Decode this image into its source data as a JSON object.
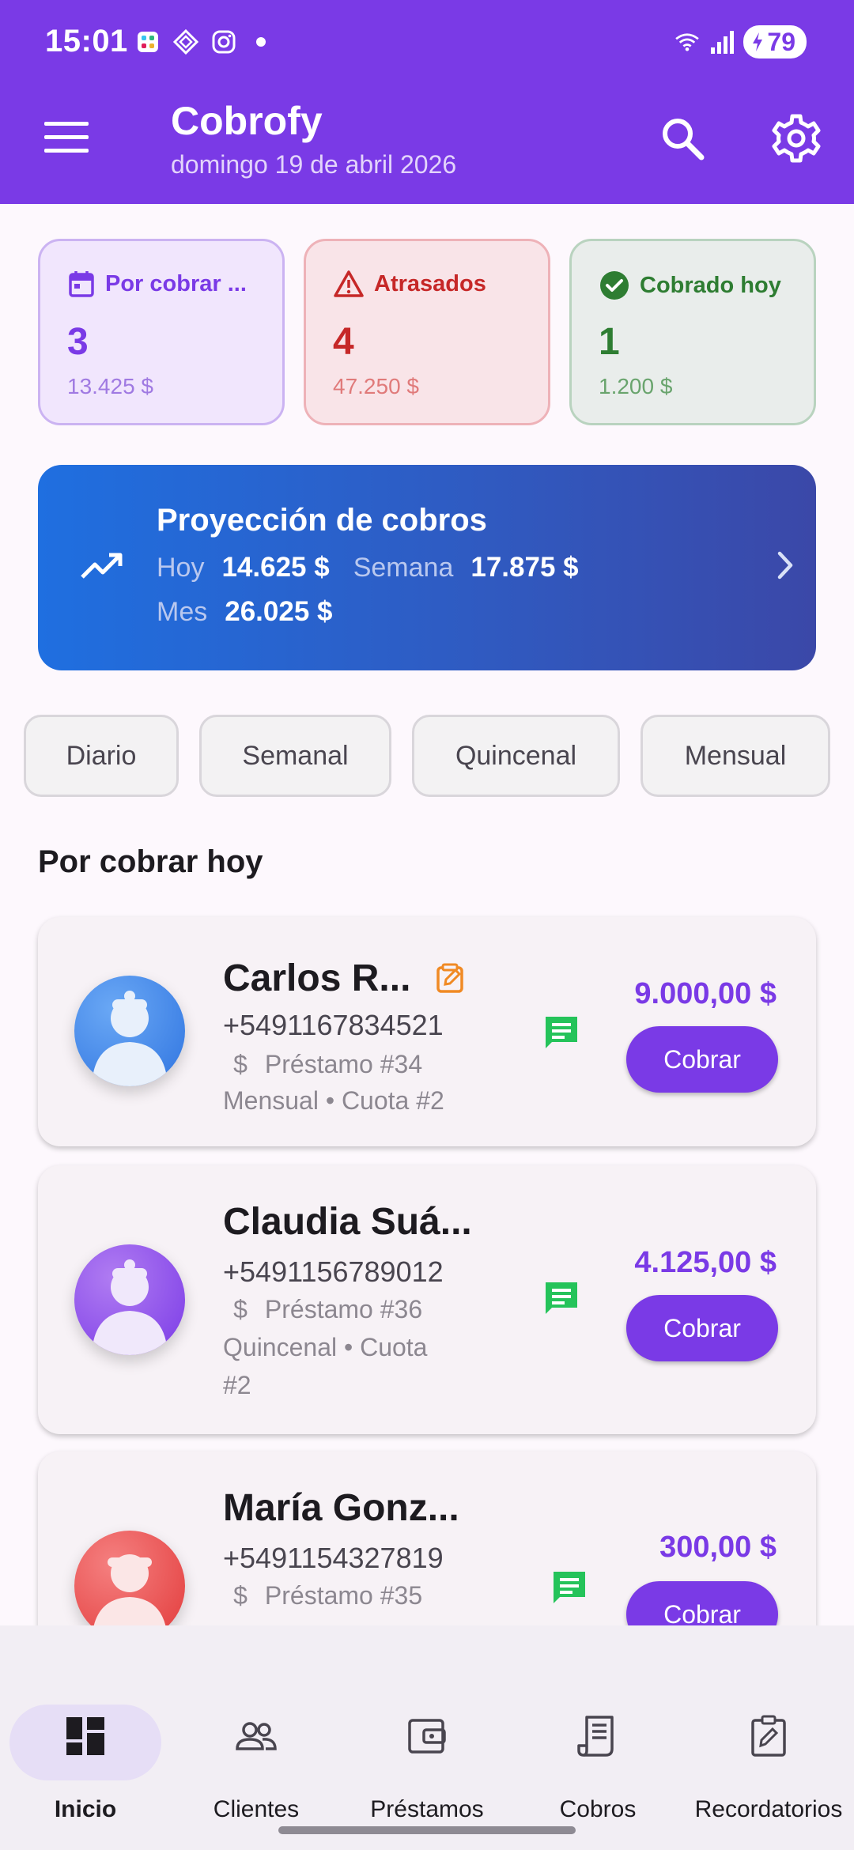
{
  "status_bar": {
    "time": "15:01",
    "battery": "79"
  },
  "app_bar": {
    "title": "Cobrofy",
    "date": "domingo 19 de abril 2026"
  },
  "summary": {
    "pending": {
      "label": "Por cobrar ...",
      "count": "3",
      "amount": "13.425 $"
    },
    "late": {
      "label": "Atrasados",
      "count": "4",
      "amount": "47.250 $"
    },
    "paid_today": {
      "label": "Cobrado hoy",
      "count": "1",
      "amount": "1.200 $"
    }
  },
  "projection": {
    "title": "Proyección de cobros",
    "today_label": "Hoy",
    "today_value": "14.625 $",
    "week_label": "Semana",
    "week_value": "17.875 $",
    "month_label": "Mes",
    "month_value": "26.025 $"
  },
  "filters": [
    "Diario",
    "Semanal",
    "Quincenal",
    "Mensual"
  ],
  "section_title": "Por cobrar hoy",
  "customers": [
    {
      "name": "Carlos R...",
      "phone": "+5491167834521",
      "loan": "Préstamo #34",
      "meta": "Mensual • Cuota #2",
      "amount": "9.000,00 $",
      "action": "Cobrar",
      "avatar_color": "#3b82e8"
    },
    {
      "name": "Claudia Suá...",
      "phone": "+5491156789012",
      "loan": "Préstamo #36",
      "meta": "Quincenal • Cuota #2",
      "amount": "4.125,00 $",
      "action": "Cobrar",
      "avatar_color": "#8a4de6"
    },
    {
      "name": "María Gonz...",
      "phone": "+5491154327819",
      "loan": "Préstamo #35",
      "meta": "",
      "amount": "300,00 $",
      "action": "Cobrar",
      "avatar_color": "#e64646"
    }
  ],
  "bottom_nav": [
    {
      "label": "Inicio",
      "icon": "dashboard-icon",
      "active": true
    },
    {
      "label": "Clientes",
      "icon": "people-icon",
      "active": false
    },
    {
      "label": "Préstamos",
      "icon": "wallet-icon",
      "active": false
    },
    {
      "label": "Cobros",
      "icon": "receipt-icon",
      "active": false
    },
    {
      "label": "Recordatorios",
      "icon": "clipboard-edit-icon",
      "active": false
    }
  ],
  "colors": {
    "primary": "#7a3ae6",
    "late": "#c62828",
    "paid": "#2e7d32",
    "whatsapp": "#25c35a",
    "edit": "#f08a24"
  }
}
